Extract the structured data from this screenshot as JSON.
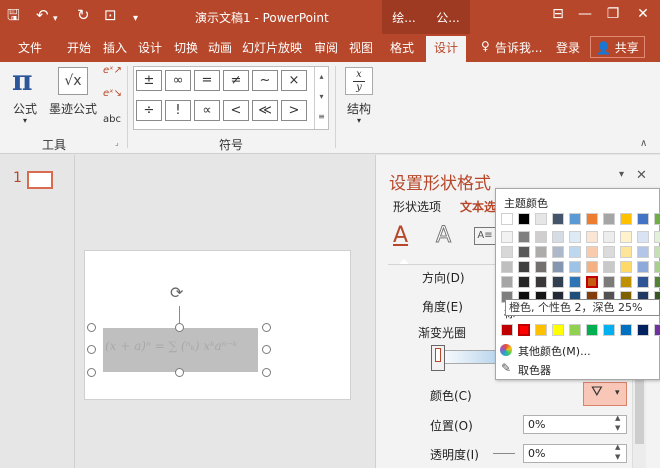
{
  "window": {
    "title": "演示文稿1 - PowerPoint",
    "context_tab_1": "绘...",
    "context_tab_2": "公...",
    "colors": {
      "accent": "#b7472a",
      "context": "#9e3a21"
    }
  },
  "tabs": {
    "file": "文件",
    "home": "开始",
    "insert": "插入",
    "design": "设计",
    "transitions": "切换",
    "animations": "动画",
    "slideshow": "幻灯片放映",
    "review": "审阅",
    "view": "视图",
    "format": "格式",
    "design_active": "设计",
    "tell_me": "告诉我...",
    "sign_in": "登录",
    "share": "共享"
  },
  "ribbon": {
    "formula_label": "公式",
    "ink_label": "墨迹公式",
    "abc_label": "abc",
    "tools_group": "工具",
    "symbols_group": "符号",
    "structure_label": "结构",
    "fraction_num": "x",
    "fraction_den": "y",
    "symbols_row1": [
      "±",
      "∞",
      "=",
      "≠",
      "~",
      "×"
    ],
    "symbols_row2": [
      "÷",
      "!",
      "∝",
      "<",
      "≪",
      ">"
    ]
  },
  "thumbnails": {
    "slide_number": "1"
  },
  "slide": {
    "equation": "(x + a)ⁿ = ∑ (ⁿₖ) xᵏaⁿ⁻ᵏ"
  },
  "pane": {
    "title": "设置形状格式",
    "tab_shape": "形状选项",
    "tab_text": "文本选",
    "direction": "方向(D)",
    "angle": "角度(E)",
    "gradient_stops": "渐变光圈",
    "color": "颜色(C)",
    "position": "位置(O)",
    "position_value": "0%",
    "transparency": "透明度(I)",
    "transparency_value": "0%"
  },
  "popup": {
    "theme_colors": "主题颜色",
    "standard_partial": "标",
    "tooltip": "橙色, 个性色 2，深色 25%",
    "more_colors": "其他颜色(M)...",
    "eyedropper": "取色器",
    "theme_top": [
      "#ffffff",
      "#000000",
      "#e7e6e6",
      "#44546a",
      "#5b9bd5",
      "#ed7d31",
      "#a5a5a5",
      "#ffc000",
      "#4472c4",
      "#70ad47"
    ],
    "theme_shades": [
      [
        "#f2f2f2",
        "#7f7f7f",
        "#d0cece",
        "#d6dce4",
        "#deebf6",
        "#fbe5d5",
        "#ededed",
        "#fff2cc",
        "#dae3f3",
        "#e2efd9"
      ],
      [
        "#d8d8d8",
        "#595959",
        "#aeabab",
        "#adb9ca",
        "#bdd7ee",
        "#f8cbad",
        "#dbdbdb",
        "#fee599",
        "#b4c6e7",
        "#c5e0b3"
      ],
      [
        "#bfbfbf",
        "#3f3f3f",
        "#757070",
        "#8496b0",
        "#9dc3e6",
        "#f4b183",
        "#c9c9c9",
        "#ffd965",
        "#8eaadb",
        "#a8d08d"
      ],
      [
        "#a5a5a5",
        "#262626",
        "#3a3838",
        "#323f4f",
        "#2e75b5",
        "#c55a11",
        "#7b7b7b",
        "#bf9000",
        "#2f5496",
        "#538135"
      ],
      [
        "#7f7f7f",
        "#0c0c0c",
        "#171616",
        "#222a35",
        "#1e4e79",
        "#833c0b",
        "#525252",
        "#7f6000",
        "#1f3864",
        "#375623"
      ]
    ],
    "standard": [
      "#c00000",
      "#ff0000",
      "#ffc000",
      "#ffff00",
      "#92d050",
      "#00b050",
      "#00b0f0",
      "#0070c0",
      "#002060",
      "#7030a0"
    ]
  }
}
